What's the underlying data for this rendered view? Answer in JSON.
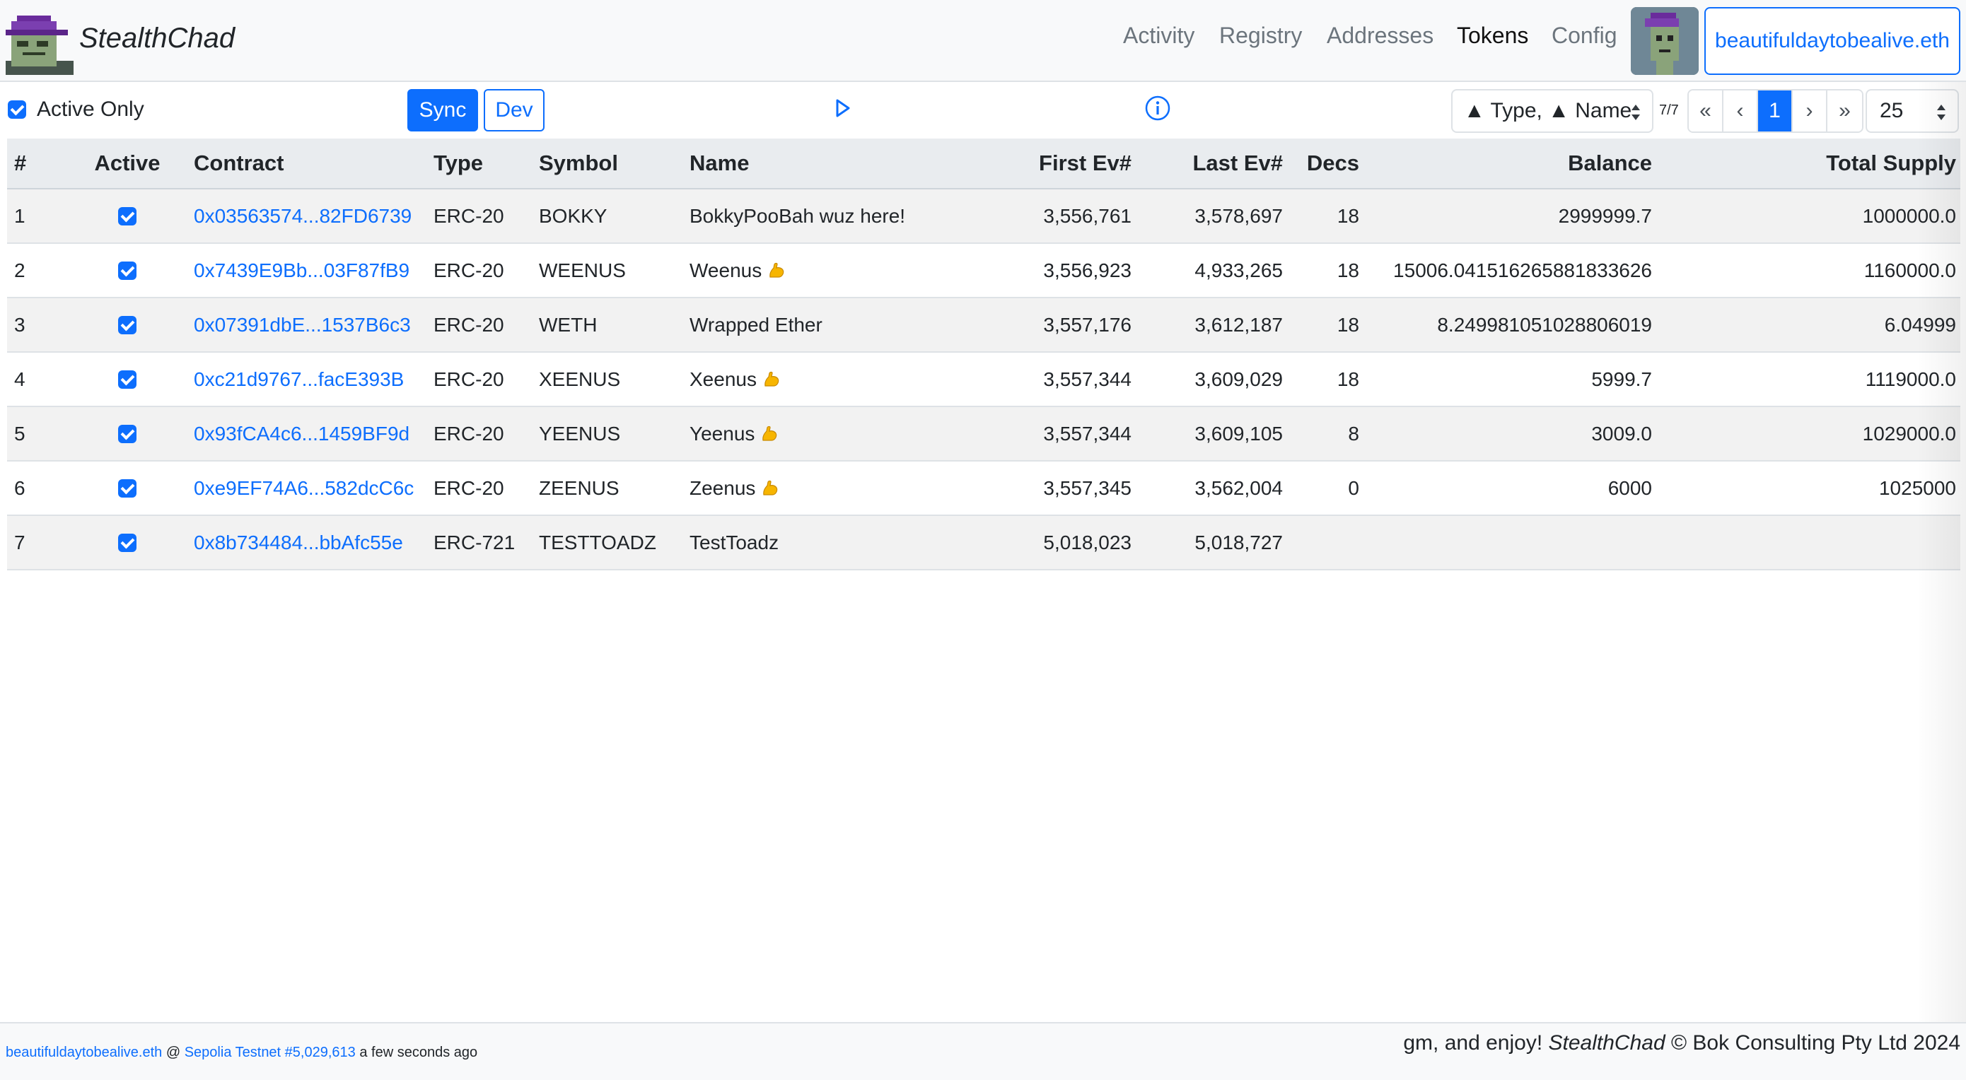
{
  "brand": {
    "name": "StealthChad"
  },
  "nav": {
    "items": [
      {
        "label": "Activity"
      },
      {
        "label": "Registry"
      },
      {
        "label": "Addresses"
      },
      {
        "label": "Tokens"
      },
      {
        "label": "Config"
      }
    ],
    "active": "Tokens",
    "account": "beautifuldaytobealive.eth"
  },
  "toolbar": {
    "active_only_label": "Active Only",
    "active_only_checked": true,
    "sync_label": "Sync",
    "dev_label": "Dev",
    "sort_value": "▲ Type, ▲ Name",
    "page_count": "7/7",
    "pager": {
      "first": "«",
      "prev": "‹",
      "current": "1",
      "next": "›",
      "last": "»"
    },
    "page_size": "25"
  },
  "table": {
    "headers": {
      "num": "#",
      "active": "Active",
      "contract": "Contract",
      "type": "Type",
      "symbol": "Symbol",
      "name": "Name",
      "first": "First Ev#",
      "last": "Last Ev#",
      "decs": "Decs",
      "balance": "Balance",
      "supply": "Total Supply"
    },
    "rows": [
      {
        "num": "1",
        "active": true,
        "contract": "0x03563574...82FD6739",
        "type": "ERC-20",
        "symbol": "BOKKY",
        "name": "BokkyPooBah wuz here!",
        "emoji": false,
        "first": "3,556,761",
        "last": "3,578,697",
        "decs": "18",
        "balance": "2999999.7",
        "supply": "1000000.0"
      },
      {
        "num": "2",
        "active": true,
        "contract": "0x7439E9Bb...03F87fB9",
        "type": "ERC-20",
        "symbol": "WEENUS",
        "name": "Weenus",
        "emoji": true,
        "first": "3,556,923",
        "last": "4,933,265",
        "decs": "18",
        "balance": "15006.041516265881833626",
        "supply": "1160000.0"
      },
      {
        "num": "3",
        "active": true,
        "contract": "0x07391dbE...1537B6c3",
        "type": "ERC-20",
        "symbol": "WETH",
        "name": "Wrapped Ether",
        "emoji": false,
        "first": "3,557,176",
        "last": "3,612,187",
        "decs": "18",
        "balance": "8.249981051028806019",
        "supply": "6.04999"
      },
      {
        "num": "4",
        "active": true,
        "contract": "0xc21d9767...facE393B",
        "type": "ERC-20",
        "symbol": "XEENUS",
        "name": "Xeenus",
        "emoji": true,
        "first": "3,557,344",
        "last": "3,609,029",
        "decs": "18",
        "balance": "5999.7",
        "supply": "1119000.0"
      },
      {
        "num": "5",
        "active": true,
        "contract": "0x93fCA4c6...1459BF9d",
        "type": "ERC-20",
        "symbol": "YEENUS",
        "name": "Yeenus",
        "emoji": true,
        "first": "3,557,344",
        "last": "3,609,105",
        "decs": "8",
        "balance": "3009.0",
        "supply": "1029000.0"
      },
      {
        "num": "6",
        "active": true,
        "contract": "0xe9EF74A6...582dcC6c",
        "type": "ERC-20",
        "symbol": "ZEENUS",
        "name": "Zeenus",
        "emoji": true,
        "first": "3,557,345",
        "last": "3,562,004",
        "decs": "0",
        "balance": "6000",
        "supply": "1025000"
      },
      {
        "num": "7",
        "active": true,
        "contract": "0x8b734484...bbAfc55e",
        "type": "ERC-721",
        "symbol": "TESTTOADZ",
        "name": "TestToadz",
        "emoji": false,
        "first": "5,018,023",
        "last": "5,018,727",
        "decs": "",
        "balance": "",
        "supply": ""
      }
    ]
  },
  "footer": {
    "account": "beautifuldaytobealive.eth",
    "at": "@",
    "network": "Sepolia Testnet #5,029,613",
    "ago": "a few seconds ago",
    "right_prefix": "gm, and enjoy!",
    "right_brand": "StealthChad",
    "right_suffix": "© Bok Consulting Pty Ltd 2024"
  },
  "colors": {
    "primary": "#0d6efd",
    "navbar_bg": "#f8f9fa",
    "stripe": "#f2f2f2",
    "header_bg": "#e9ecef"
  },
  "icons": {
    "logo": "pixel-punk-logo",
    "avatar": "pixel-punk-avatar",
    "play": "play-icon",
    "info": "info-icon",
    "emoji": "flexed-biceps-emoji"
  }
}
